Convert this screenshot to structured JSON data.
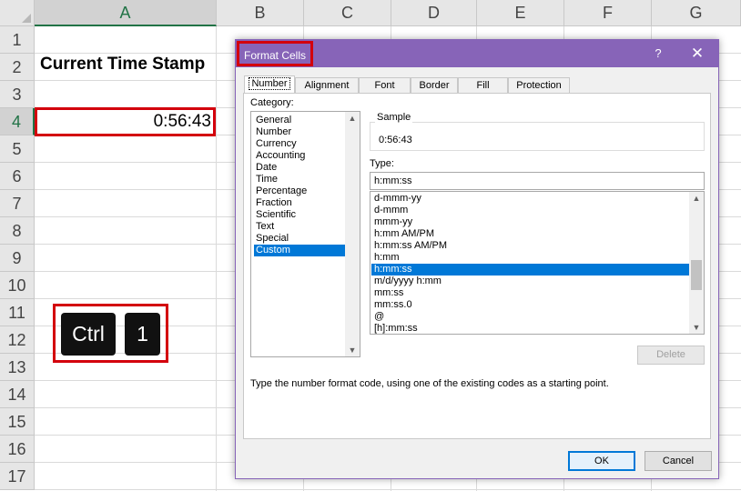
{
  "sheet": {
    "columns": [
      "A",
      "B",
      "C",
      "D",
      "E",
      "F",
      "G"
    ],
    "selected_column": "A",
    "rows": [
      "1",
      "2",
      "3",
      "4",
      "5",
      "6",
      "7",
      "8",
      "9",
      "10",
      "11",
      "12",
      "13",
      "14",
      "15",
      "16",
      "17"
    ],
    "selected_row": "4",
    "title_cell": "Current Time Stamp",
    "time_cell": "0:56:43",
    "keys": [
      "Ctrl",
      "1"
    ],
    "highlight_color": "#d3000c",
    "accent_color": "#217346"
  },
  "dialog": {
    "title": "Format Cells",
    "help_glyph": "?",
    "close_glyph": "✕",
    "accent_color": "#8764b8",
    "tabs": [
      "Number",
      "Alignment",
      "Font",
      "Border",
      "Fill",
      "Protection"
    ],
    "active_tab": "Number",
    "category_label": "Category:",
    "categories": [
      "General",
      "Number",
      "Currency",
      "Accounting",
      "Date",
      "Time",
      "Percentage",
      "Fraction",
      "Scientific",
      "Text",
      "Special",
      "Custom"
    ],
    "selected_category": "Custom",
    "sample_label": "Sample",
    "sample_value": "0:56:43",
    "type_label": "Type:",
    "type_value": "h:mm:ss",
    "formats": [
      "d-mmm-yy",
      "d-mmm",
      "mmm-yy",
      "h:mm AM/PM",
      "h:mm:ss AM/PM",
      "h:mm",
      "h:mm:ss",
      "m/d/yyyy h:mm",
      "mm:ss",
      "mm:ss.0",
      "@",
      "[h]:mm:ss"
    ],
    "selected_format": "h:mm:ss",
    "delete_label": "Delete",
    "hint": "Type the number format code, using one of the existing codes as a starting point.",
    "ok_label": "OK",
    "cancel_label": "Cancel",
    "selection_color": "#0078d7"
  }
}
